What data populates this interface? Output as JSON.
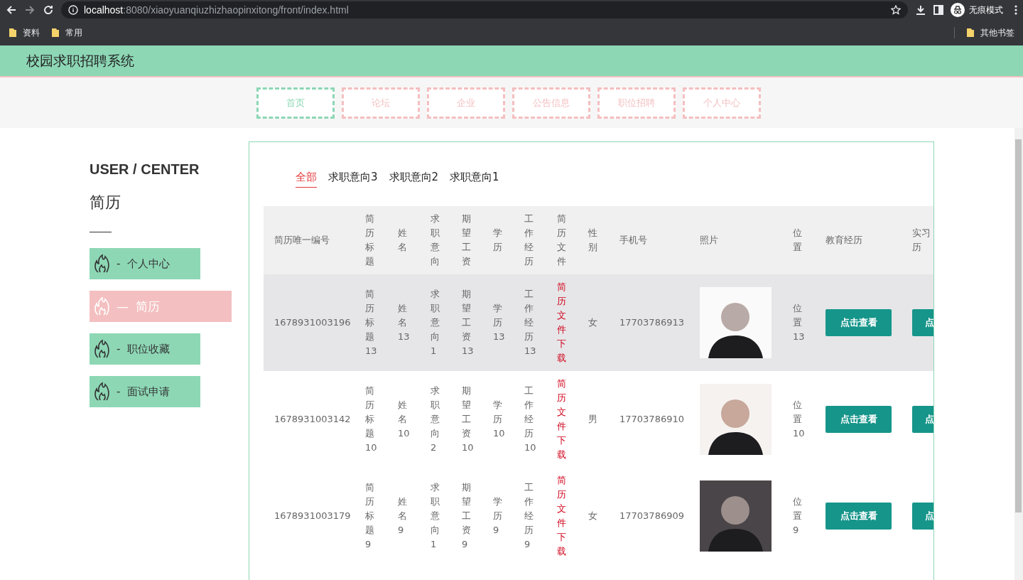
{
  "browser": {
    "url_host": "localhost",
    "url_rest": ":8080/xiaoyuanqiuzhizhaopinxitong/front/index.html",
    "incognito_label": "无痕模式",
    "bookmarks": [
      "资料",
      "常用"
    ],
    "other_bookmarks": "其他书签"
  },
  "site_title": "校园求职招聘系统",
  "nav": [
    {
      "label": "首页",
      "selected": true
    },
    {
      "label": "论坛",
      "selected": false
    },
    {
      "label": "企业",
      "selected": false
    },
    {
      "label": "公告信息",
      "selected": false
    },
    {
      "label": "职位招聘",
      "selected": false
    },
    {
      "label": "个人中心",
      "selected": false
    }
  ],
  "sidebar": {
    "heading": "USER / CENTER",
    "subtitle": "简历",
    "items": [
      {
        "prefix": "-",
        "label": "个人中心",
        "selected": false
      },
      {
        "prefix": "—",
        "label": "简历",
        "selected": true
      },
      {
        "prefix": "-",
        "label": "职位收藏",
        "selected": false
      },
      {
        "prefix": "-",
        "label": "面试申请",
        "selected": false
      }
    ]
  },
  "tabs": [
    {
      "label": "全部",
      "selected": true
    },
    {
      "label": "求职意向3",
      "selected": false
    },
    {
      "label": "求职意向2",
      "selected": false
    },
    {
      "label": "求职意向1",
      "selected": false
    }
  ],
  "table": {
    "columns": [
      "简历唯一编号",
      "简历标题",
      "姓名",
      "求职意向",
      "期望工资",
      "学历",
      "工作经历",
      "简历文件",
      "性别",
      "手机号",
      "照片",
      "位置",
      "教育经历",
      "实习历"
    ],
    "rows": [
      {
        "hovered": true,
        "id": "1678931003196",
        "resume_title": "简历标题13",
        "name": "姓名13",
        "job_intention": "求职意向1",
        "expected_salary": "期望工资13",
        "education": "学历13",
        "work_experience": "工作经历13",
        "resume_file": "简历文件下载",
        "gender": "女",
        "phone": "17703786913",
        "position": "位置13",
        "education_history": "点击查看",
        "internship": "点"
      },
      {
        "hovered": false,
        "id": "1678931003142",
        "resume_title": "简历标题10",
        "name": "姓名10",
        "job_intention": "求职意向2",
        "expected_salary": "期望工资10",
        "education": "学历10",
        "work_experience": "工作经历10",
        "resume_file": "简历文件下载",
        "gender": "男",
        "phone": "17703786910",
        "position": "位置10",
        "education_history": "点击查看",
        "internship": "点"
      },
      {
        "hovered": false,
        "id": "1678931003179",
        "resume_title": "简历标题9",
        "name": "姓名9",
        "job_intention": "求职意向1",
        "expected_salary": "期望工资9",
        "education": "学历9",
        "work_experience": "工作经历9",
        "resume_file": "简历文件下载",
        "gender": "女",
        "phone": "17703786909",
        "position": "位置9",
        "education_history": "点击查看",
        "internship": "点"
      }
    ]
  }
}
